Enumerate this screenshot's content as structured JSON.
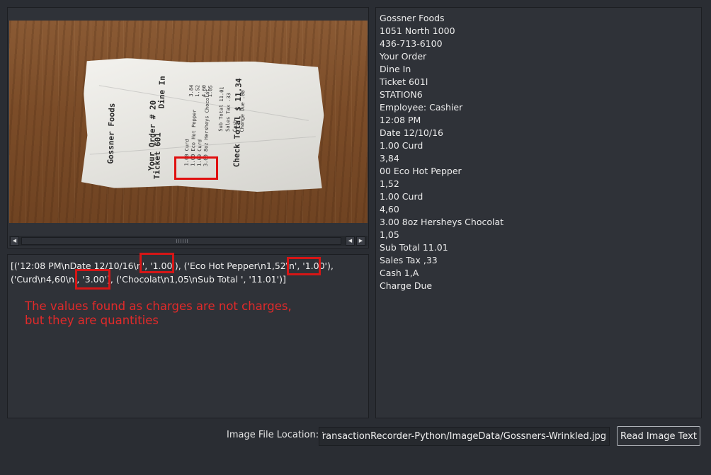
{
  "image_viewer": {
    "receipt_ink": {
      "store": "Gossner Foods",
      "order": "Your Order # 20",
      "ticket": "Ticket 601",
      "dine": "Dine In",
      "total": "Check Total $ 11.34",
      "items": "1.00 Curd\n1.00 Eco Hot Pepper\n1.00 Curd\n3.00 8oz Hersheys Chocolat",
      "prices": "3.84\n1.52\n4.60\n1.05",
      "summary": "Sub Total 11.01\nSales Tax .33\nCash\nChange Due .00"
    },
    "scroll_left_icon": "◀",
    "scroll_right_icon": "▶"
  },
  "output": {
    "text": "[('12:08 PM\\nDate 12/10/16\\n', '1.00'), ('Eco Hot Pepper\\n1,52\\n', '1.00'),\n('Curd\\n4,60\\n', '3.00'), ('Chocolat\\n1,05\\nSub Total ', '11.01')]",
    "annotation": "The values found as charges are not charges,\nbut they are quantities",
    "highlight_color": "#d61616"
  },
  "ocr_result": {
    "lines": [
      "Gossner Foods",
      "1051 North 1000",
      "436-713-6100",
      "Your Order",
      "Dine In",
      "Ticket 601l",
      "STATION6",
      "Employee: Cashier",
      "12:08 PM",
      "Date 12/10/16",
      "1.00 Curd",
      "3,84",
      "00 Eco Hot Pepper",
      "1,52",
      "1.00 Curd",
      "4,60",
      "3.00 8oz Hersheys Chocolat",
      "1,05",
      "Sub Total 11.01",
      "Sales Tax ,33",
      "Cash 1,A",
      "Charge Due"
    ]
  },
  "footer": {
    "file_label": "Image File Location:",
    "file_path": "ptTransactionRecorder-Python/ImageData/Gossners-Wrinkled.jpg",
    "read_button": "Read Image Text"
  },
  "theme": {
    "background": "#2a2d33",
    "panel": "#2f3238",
    "accent_red": "#e01010"
  }
}
